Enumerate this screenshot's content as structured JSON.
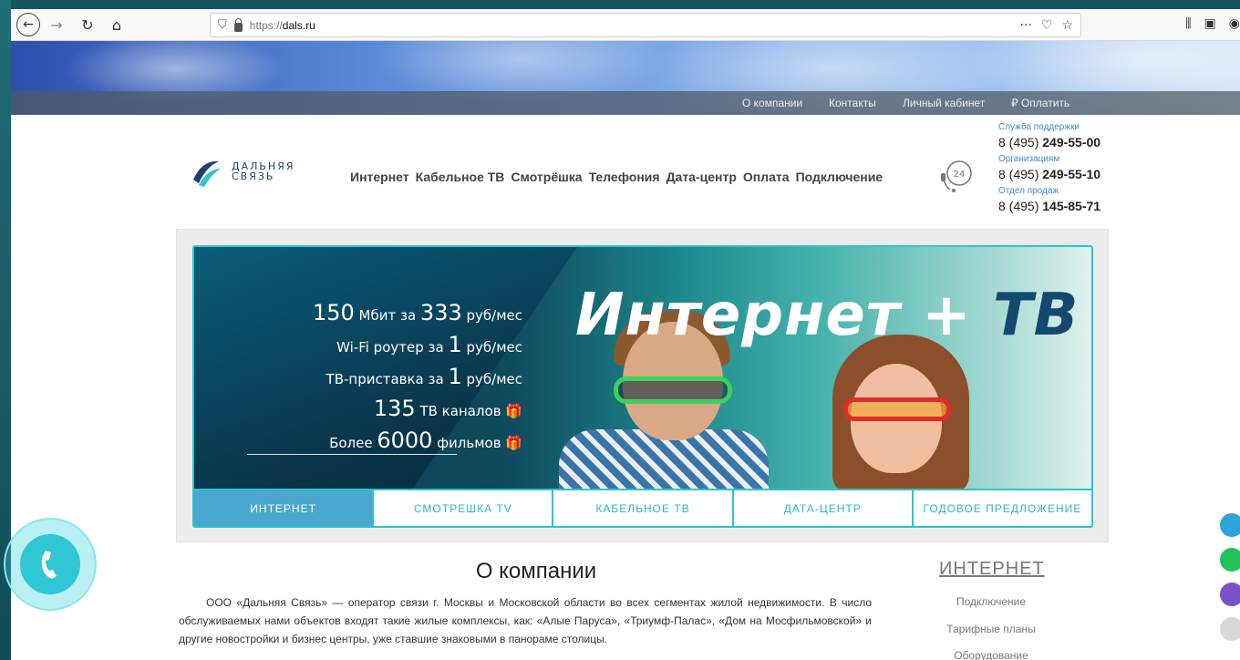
{
  "browser": {
    "url_scheme": "https://",
    "url_host": "dals.ru",
    "page_actions": "···"
  },
  "top_links": [
    "О компании",
    "Контакты",
    "Личный кабинет",
    "₽ Оплатить"
  ],
  "logo": {
    "line1": "ДАЛЬНЯЯ",
    "line2": "СВЯЗЬ"
  },
  "nav": [
    "Интернет",
    "Кабельное ТВ",
    "Смотрёшка",
    "Телефония",
    "Дата-центр",
    "Оплата",
    "Подключение"
  ],
  "contacts": [
    {
      "label": "Служба поддержки",
      "prefix": "8 (495)",
      "number": "249-55-00"
    },
    {
      "label": "Организациям",
      "prefix": "8 (495)",
      "number": "249-55-10"
    },
    {
      "label": "Отдел продаж",
      "prefix": "8 (495)",
      "number": "145-85-71"
    }
  ],
  "banner": {
    "headline_main": "Интернет + ",
    "headline_tv": "ТВ",
    "offers": [
      {
        "big": "150",
        "text": " Мбит за ",
        "big2": "333",
        "text2": " руб/мес"
      },
      {
        "big": "",
        "text": "Wi-Fi роутер за ",
        "big2": "1",
        "text2": " руб/мес"
      },
      {
        "big": "",
        "text": "ТВ-приставка за ",
        "big2": "1",
        "text2": " руб/мес"
      },
      {
        "big": "135",
        "text": " ТВ каналов ",
        "big2": "",
        "text2": ""
      },
      {
        "big": "",
        "text": "Более ",
        "big2": "6000",
        "text2": " фильмов "
      }
    ]
  },
  "tabs": [
    "ИНТЕРНЕТ",
    "СМОТРЕШКА TV",
    "КАБЕЛЬНОЕ ТВ",
    "ДАТА-ЦЕНТР",
    "ГОДОВОЕ ПРЕДЛОЖЕНИЕ"
  ],
  "about": {
    "title": "О компании",
    "text": "ООО «Дальняя Связь» — оператор связи г. Москвы и Московской области во всех сегментах жилой недвижимости. В число обслуживаемых нами объектов входят такие жилые комплексы, как: «Алые Паруса», «Триумф-Палас», «Дом на Мосфильмовской» и другие новостройки и бизнес центры, уже ставшие знаковыми в панораме столицы."
  },
  "sidebar": {
    "title": "ИНТЕРНЕТ",
    "links": [
      "Подключение",
      "Тарифные планы",
      "Оборудование"
    ]
  },
  "colors": {
    "accent": "#2ec4cb",
    "active_tab": "#4aa7cf",
    "link_blue": "#3f8bd6"
  }
}
